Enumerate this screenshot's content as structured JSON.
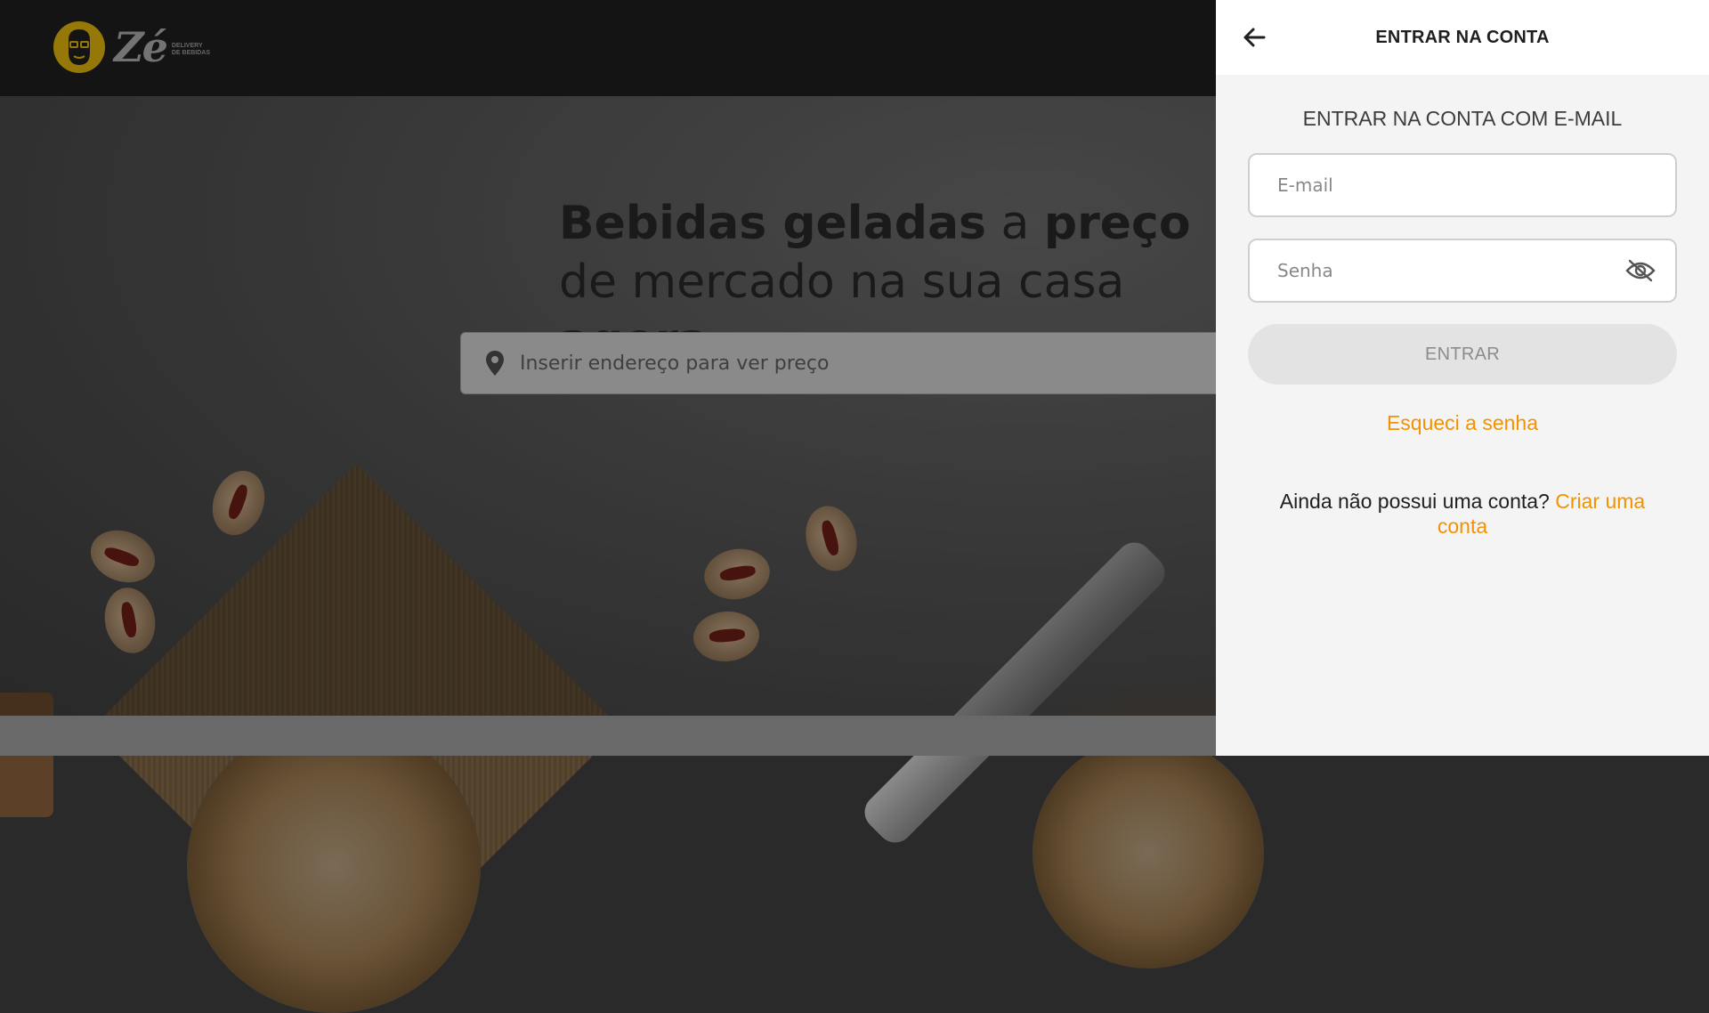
{
  "brand": {
    "logo_text": "Zé",
    "logo_subtext": "DELIVERY DE BEBIDAS",
    "accent_color": "#f39200",
    "logo_badge_color": "#c9a10c"
  },
  "hero": {
    "title_part1_bold": "Bebidas geladas",
    "title_part2": " a ",
    "title_part3_bold": "preço",
    "title_part4": " de mercado na sua casa ",
    "title_part5_bold": "agora"
  },
  "search": {
    "placeholder": "Inserir endereço para ver preço",
    "icon": "map-pin-icon"
  },
  "drawer": {
    "header_title": "ENTRAR NA CONTA",
    "back_icon": "arrow-left-icon",
    "subtitle": "ENTRAR NA CONTA COM E-MAIL",
    "email_placeholder": "E-mail",
    "password_placeholder": "Senha",
    "password_toggle_icon": "eye-off-icon",
    "submit_label": "ENTRAR",
    "forgot_label": "Esqueci a senha",
    "signup_prompt": "Ainda não possui uma conta?",
    "signup_link": "Criar uma conta"
  }
}
